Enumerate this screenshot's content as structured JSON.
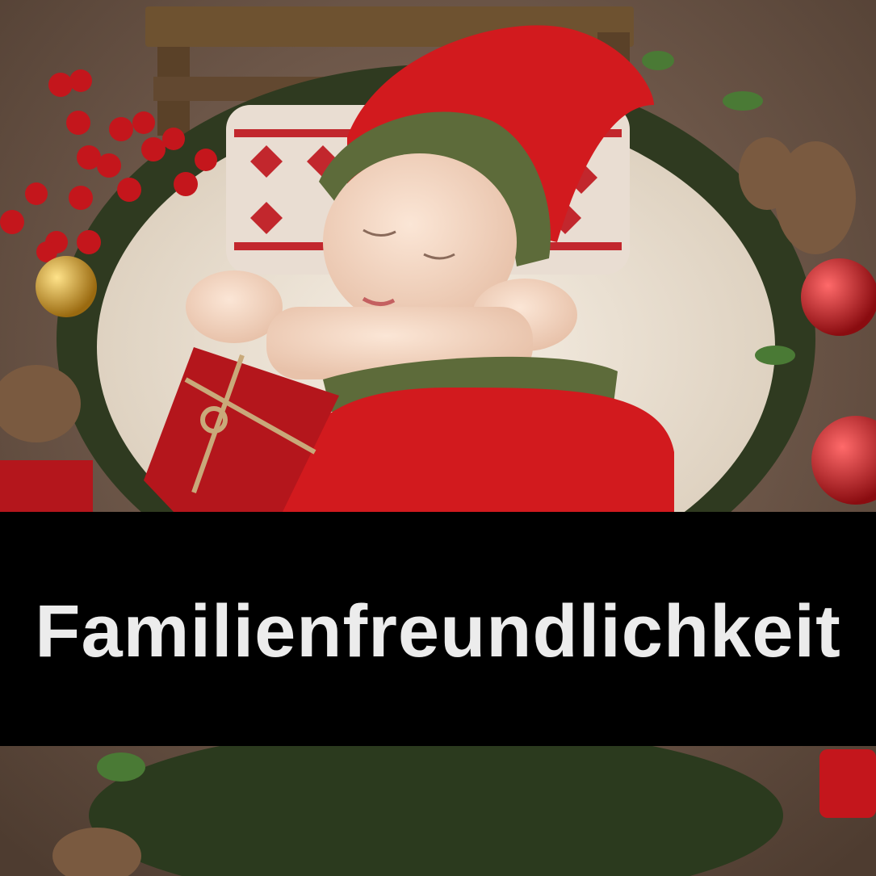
{
  "banner": {
    "text": "Familienfreundlichkeit"
  },
  "colors": {
    "banner_background": "#000000",
    "banner_text": "#ececec",
    "knit_red": "#d21a1e",
    "knit_green": "#5d6b3a",
    "fur_cream": "#efe6d8",
    "backdrop_brown": "#6b5446"
  }
}
